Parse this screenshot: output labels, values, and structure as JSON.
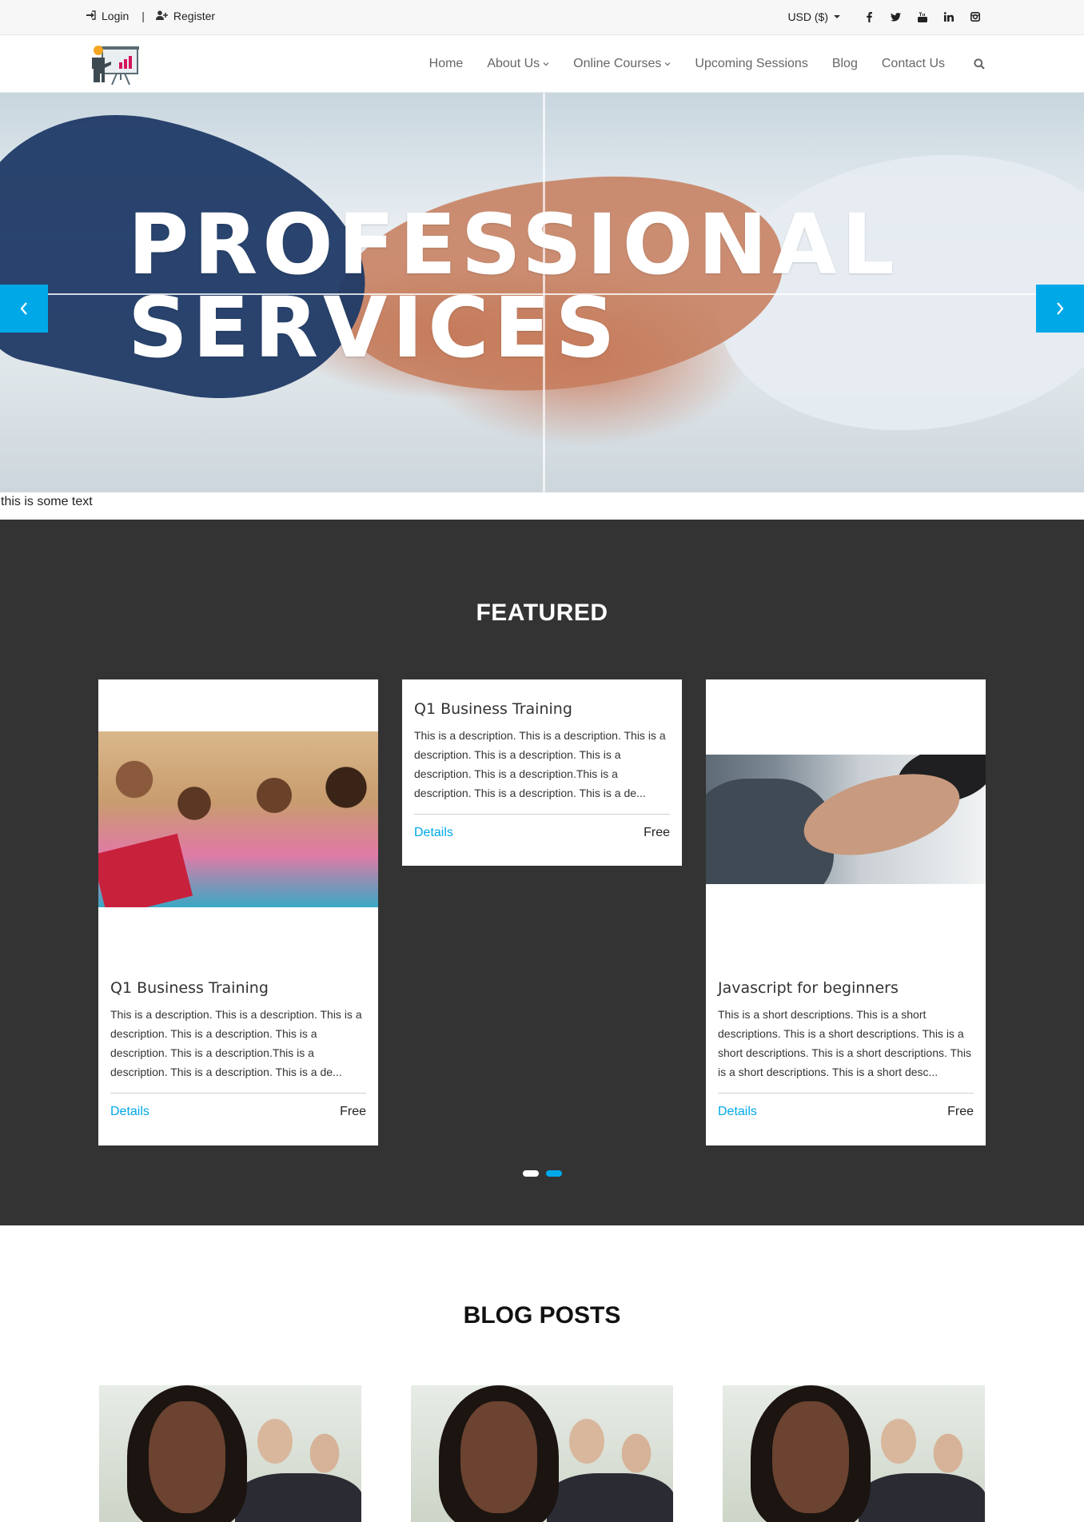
{
  "topbar": {
    "login_label": "Login",
    "separator": "|",
    "register_label": "Register",
    "currency_label": "USD ($)",
    "social": [
      "facebook-icon",
      "twitter-icon",
      "youtube-icon",
      "linkedin-icon",
      "instagram-icon"
    ]
  },
  "nav": {
    "items": [
      {
        "label": "Home",
        "dropdown": false
      },
      {
        "label": "About Us",
        "dropdown": true
      },
      {
        "label": "Online Courses",
        "dropdown": true
      },
      {
        "label": "Upcoming Sessions",
        "dropdown": false
      },
      {
        "label": "Blog",
        "dropdown": false
      },
      {
        "label": "Contact Us",
        "dropdown": false
      }
    ]
  },
  "hero": {
    "line1": "PROFESSIONAL",
    "line2": "SERVICES",
    "caption": "this is some text"
  },
  "featured": {
    "heading": "FEATURED",
    "cards": [
      {
        "title": "Q1 Business Training",
        "description": "This is a description. This is a description. This is a description. This is a description. This is a description. This is a description.This is a description. This is a description. This is a de...",
        "details_label": "Details",
        "price": "Free"
      },
      {
        "title": "Q1 Business Training",
        "description": "This is a description. This is a description. This is a description. This is a description. This is a description. This is a description.This is a description. This is a description. This is a de...",
        "details_label": "Details",
        "price": "Free"
      },
      {
        "title": "Javascript for beginners",
        "description": "This is a short descriptions. This is a short descriptions. This is a short descriptions. This is a short descriptions. This is a short descriptions. This is a short descriptions. This is a short desc...",
        "details_label": "Details",
        "price": "Free"
      }
    ],
    "active_dot": 2
  },
  "blog": {
    "heading": "BLOG POSTS"
  },
  "colors": {
    "accent": "#00a8e8",
    "dark_section": "#333333"
  }
}
